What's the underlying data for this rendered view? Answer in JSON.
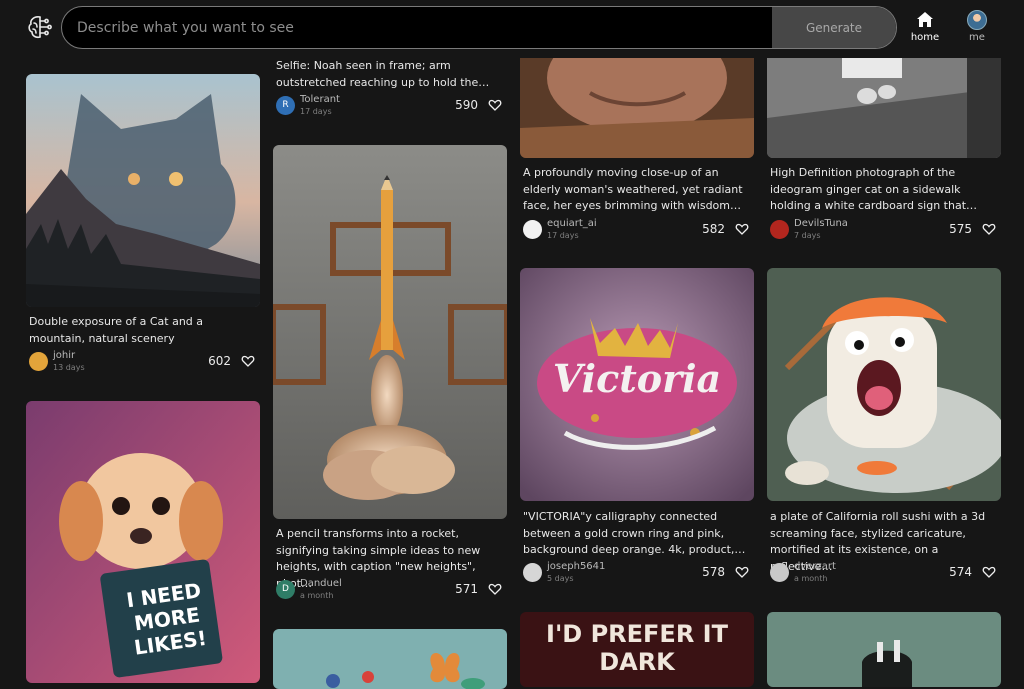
{
  "header": {
    "search_placeholder": "Describe what you want to see",
    "generate_label": "Generate",
    "nav_home": "home",
    "nav_me": "me"
  },
  "cards": {
    "c1": {
      "user": "Tolerant",
      "days": "17 days",
      "likes": "590",
      "caption": "Selfie: Noah seen in frame; arm outstretched reaching up to hold the…",
      "avatar": "R"
    },
    "c2": {
      "user": "equiart_ai",
      "days": "17 days",
      "likes": "582",
      "caption": "A profoundly moving close-up of an elderly woman's weathered, yet radiant face, her eyes brimming with wisdom…"
    },
    "c3": {
      "user": "DevilsTuna",
      "days": "7 days",
      "likes": "575",
      "caption": "High Definition photograph of the ideogram ginger cat on a sidewalk holding a white cardboard sign that…"
    },
    "c4": {
      "user": "johir",
      "days": "13 days",
      "likes": "602",
      "caption": "Double exposure of a Cat and a mountain, natural scenery"
    },
    "c5": {
      "user": "Danduel",
      "days": "a month",
      "likes": "571",
      "caption": "A pencil transforms into a rocket, signifying taking simple ideas to new heights, with caption \"new heights\", phot…",
      "avatar": "D"
    },
    "c6": {
      "user": "joseph5641",
      "days": "5 days",
      "likes": "578",
      "caption": "\"VICTORIA\"y calligraphy connected between a gold crown ring and pink, background deep orange. 4k, product,…",
      "art_text": "Victoria"
    },
    "c7": {
      "user": "dverzart",
      "days": "a month",
      "likes": "574",
      "caption": "a plate of California roll sushi with a 3d screaming face, stylized caricature, mortified at its existence, on a reflective…"
    },
    "c8": {
      "sign_text": "I NEED MORE LIKES!"
    },
    "c9": {
      "sign_text": "I'D PREFER IT DARK"
    }
  },
  "colors": {
    "background": "#161616",
    "generate_button": "#474747",
    "search_border": "#7a7a7a"
  }
}
